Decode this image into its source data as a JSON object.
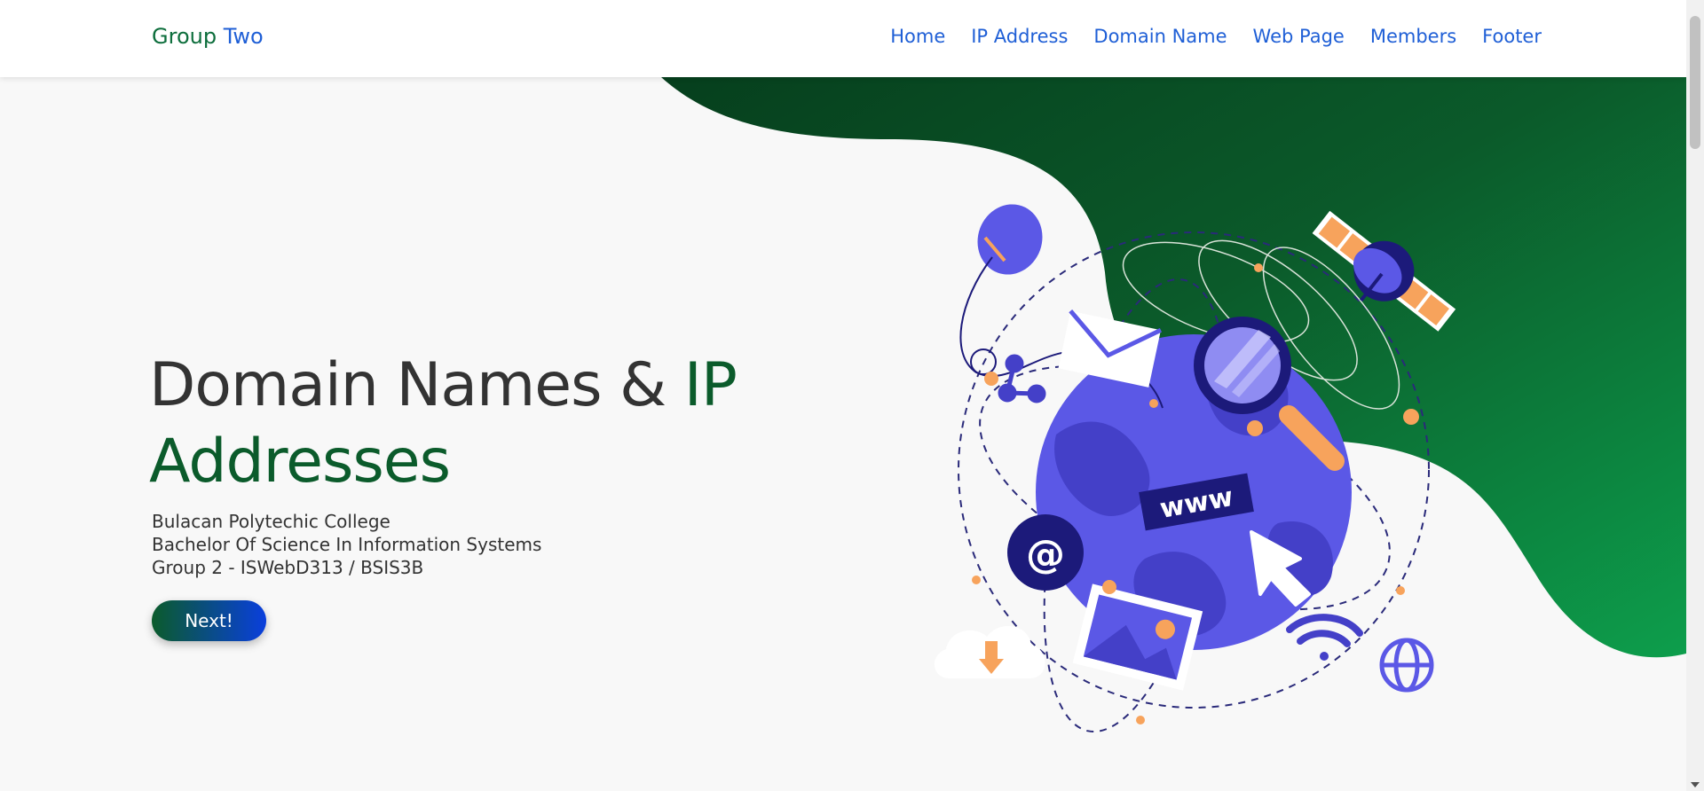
{
  "navbar": {
    "brand_primary": "Group",
    "brand_accent": "Two",
    "links": [
      "Home",
      "IP Address",
      "Domain Name",
      "Web Page",
      "Members",
      "Footer"
    ]
  },
  "hero": {
    "title_part1": "Domain Names & ",
    "title_part2": "IP",
    "title_part3": "Addresses",
    "subtitle_lines": [
      "Bulacan Polytechic College",
      "Bachelor Of Science In Information Systems",
      "Group 2 - ISWebD313 / BSIS3B"
    ],
    "button_label": "Next!"
  },
  "illustration": {
    "www_text": "www",
    "at_symbol": "@"
  },
  "colors": {
    "brand_green": "#0d6e3c",
    "accent_blue": "#1f5fd6",
    "globe_purple": "#5b58e6",
    "highlight_orange": "#f7a35c"
  }
}
